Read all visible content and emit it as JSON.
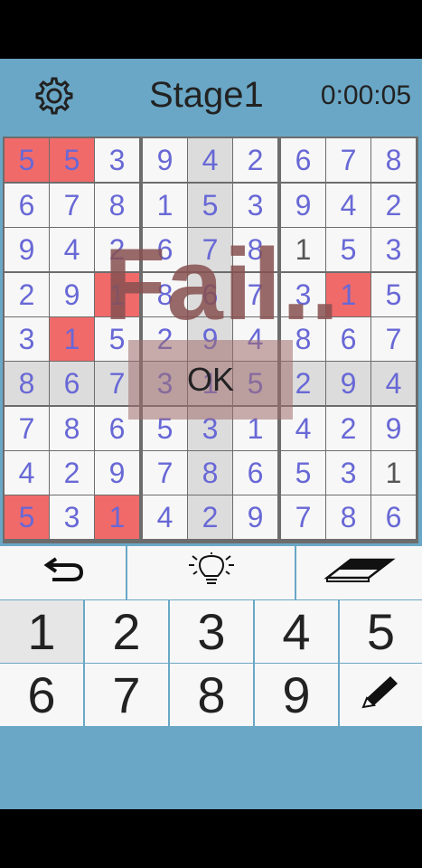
{
  "header": {
    "stage": "Stage1",
    "timer": "0:00:05",
    "settings_icon": "gear-icon"
  },
  "board": [
    [
      "5",
      "5",
      "3",
      "9",
      "4",
      "2",
      "6",
      "7",
      "8"
    ],
    [
      "6",
      "7",
      "8",
      "1",
      "5",
      "3",
      "9",
      "4",
      "2"
    ],
    [
      "9",
      "4",
      "2",
      "6",
      "7",
      "8",
      "1",
      "5",
      "3"
    ],
    [
      "2",
      "9",
      "1",
      "8",
      "6",
      "7",
      "3",
      "1",
      "5"
    ],
    [
      "3",
      "1",
      "5",
      "2",
      "9",
      "4",
      "8",
      "6",
      "7"
    ],
    [
      "8",
      "6",
      "7",
      "3",
      "1",
      "5",
      "2",
      "9",
      "4"
    ],
    [
      "7",
      "8",
      "6",
      "5",
      "3",
      "1",
      "4",
      "2",
      "9"
    ],
    [
      "4",
      "2",
      "9",
      "7",
      "8",
      "6",
      "5",
      "3",
      "1"
    ],
    [
      "5",
      "3",
      "1",
      "4",
      "2",
      "9",
      "7",
      "8",
      "6"
    ]
  ],
  "given_cells": [
    "2-6",
    "7-8"
  ],
  "highlighted_column": 4,
  "highlighted_row": 5,
  "error_cells": [
    "0-0",
    "0-1",
    "3-2",
    "3-7",
    "4-1",
    "8-0",
    "8-2"
  ],
  "dialog": {
    "message": "Fail..",
    "ok_label": "OK"
  },
  "tools": [
    {
      "name": "undo-icon"
    },
    {
      "name": "lightbulb-icon"
    },
    {
      "name": "eraser-icon"
    }
  ],
  "keypad": [
    "1",
    "2",
    "3",
    "4",
    "5",
    "6",
    "7",
    "8",
    "9"
  ],
  "keypad_extra": "pencil-icon",
  "keypad_active": "1",
  "colors": {
    "background": "#6aa7c6",
    "error": "#f06a6a",
    "digit": "#6868d6",
    "highlight": "#dcdcdc"
  }
}
